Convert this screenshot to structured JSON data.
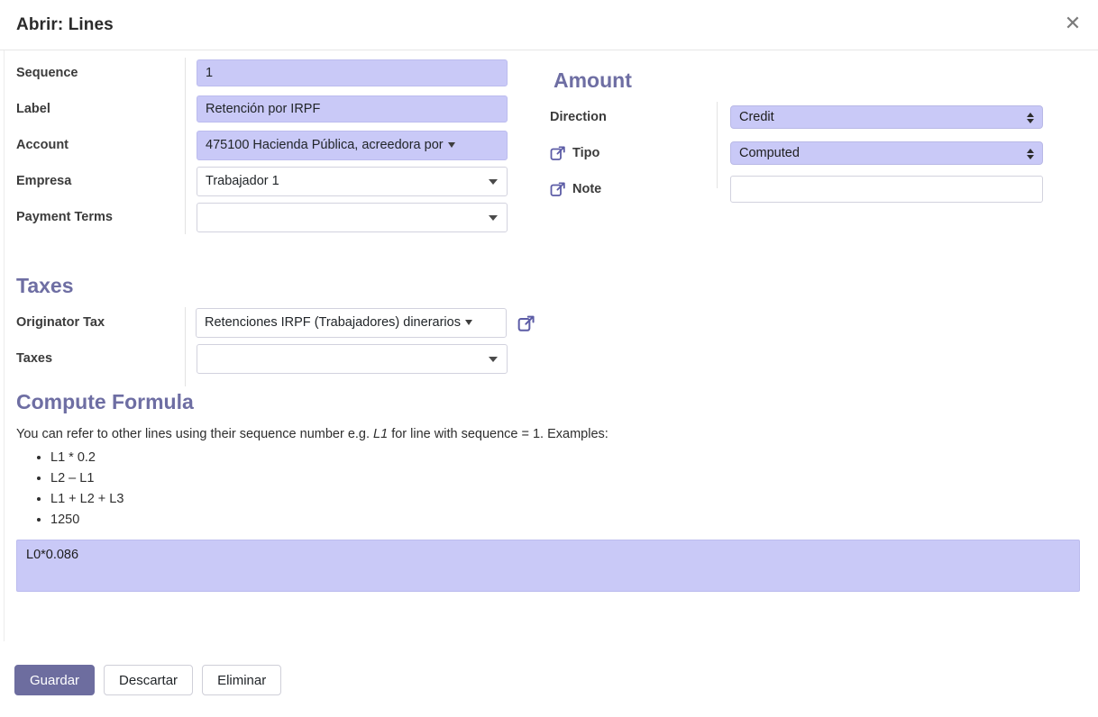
{
  "header": {
    "title": "Abrir: Lines",
    "close_icon": "close-icon"
  },
  "form": {
    "left_section": {
      "fields": [
        {
          "label": "Sequence",
          "value": "1",
          "type": "text",
          "highlighted": true
        },
        {
          "label": "Label",
          "value": "Retención por IRPF",
          "type": "text",
          "highlighted": true
        },
        {
          "label": "Account",
          "value": "475100 Hacienda Pública, acreedora por",
          "type": "select2-inline",
          "highlighted": true
        },
        {
          "label": "Empresa",
          "value": "Trabajador 1",
          "type": "select2",
          "highlighted": false
        },
        {
          "label": "Payment Terms",
          "value": "",
          "type": "select2",
          "highlighted": false
        }
      ]
    },
    "amount_section": {
      "title": "Amount",
      "fields": [
        {
          "label": "Direction",
          "value": "Credit",
          "type": "native-select",
          "highlighted": true,
          "icon": ""
        },
        {
          "label": "Tipo",
          "value": "Computed",
          "type": "native-select",
          "highlighted": true,
          "icon": "external-link-icon"
        },
        {
          "label": "Note",
          "value": "",
          "type": "text",
          "highlighted": false,
          "icon": "external-link-icon"
        }
      ]
    },
    "taxes_section": {
      "title": "Taxes",
      "fields": [
        {
          "label": "Originator Tax",
          "value": "Retenciones IRPF (Trabajadores) dinerarios",
          "type": "select2-inline",
          "highlighted": false,
          "icon": "external-link-icon"
        },
        {
          "label": "Taxes",
          "value": "",
          "type": "select2",
          "highlighted": false,
          "icon": ""
        }
      ]
    },
    "compute_section": {
      "title": "Compute Formula",
      "description_before": "You can refer to other lines using their sequence number e.g. ",
      "description_emphasis": "L1",
      "description_after": " for line with sequence = 1. Examples:",
      "examples": [
        "L1 * 0.2",
        "L2 – L1",
        "L1 + L2 + L3",
        "1250"
      ],
      "formula_value": "L0*0.086",
      "formula_placeholder": ""
    }
  },
  "footer": {
    "save_label": "Guardar",
    "discard_label": "Descartar",
    "delete_label": "Eliminar"
  },
  "colors": {
    "accent": "#6e6ea3",
    "field_highlight": "#c9c9f7",
    "primary_button": "#6d6d9f"
  }
}
